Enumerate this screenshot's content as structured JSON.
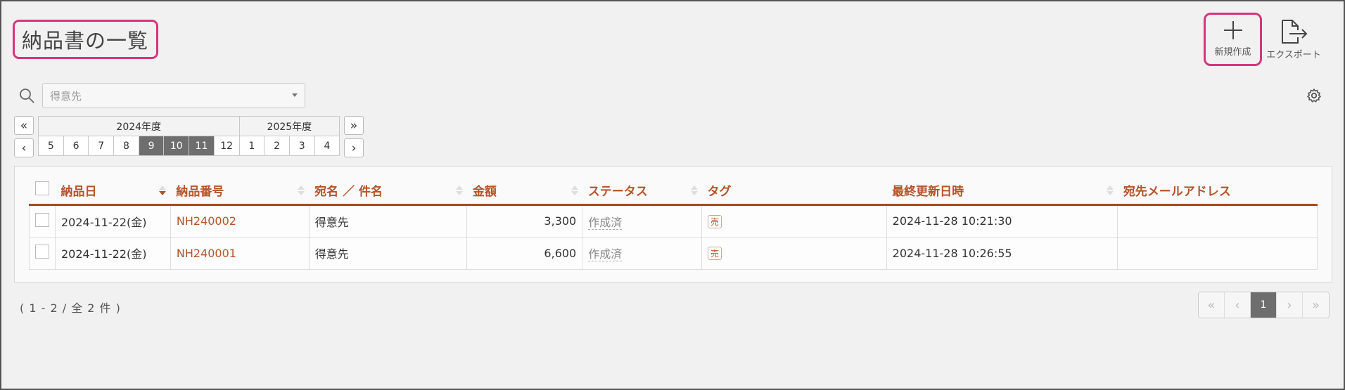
{
  "page": {
    "title": "納品書の一覧"
  },
  "toolbar": {
    "new_label": "新規作成",
    "export_label": "エクスポート"
  },
  "search": {
    "placeholder": "得意先"
  },
  "period": {
    "prev_year": "«",
    "next_year": "»",
    "prev_month": "‹",
    "next_month": "›",
    "fiscal_years": [
      "2024年度",
      "2025年度"
    ],
    "months": [
      "5",
      "6",
      "7",
      "8",
      "9",
      "10",
      "11",
      "12",
      "1",
      "2",
      "3",
      "4"
    ],
    "selected_months": [
      "9",
      "10",
      "11"
    ]
  },
  "table": {
    "headers": [
      "納品日",
      "納品番号",
      "宛名 ／ 件名",
      "金額",
      "ステータス",
      "タグ",
      "最終更新日時",
      "宛先メールアドレス"
    ],
    "rows": [
      {
        "date": "2024-11-22(金)",
        "number": "NH240002",
        "recipient": "得意先",
        "amount": "3,300",
        "status": "作成済",
        "tag": "売",
        "updated": "2024-11-28 10:21:30",
        "email": ""
      },
      {
        "date": "2024-11-22(金)",
        "number": "NH240001",
        "recipient": "得意先",
        "amount": "6,600",
        "status": "作成済",
        "tag": "売",
        "updated": "2024-11-28 10:26:55",
        "email": ""
      }
    ]
  },
  "footer": {
    "count_text": "( 1 - 2 / 全 2 件 )",
    "pagination": {
      "first": "«",
      "prev": "‹",
      "current": "1",
      "next": "›",
      "last": "»"
    }
  },
  "colors": {
    "accent": "#b5532a",
    "highlight": "#d6367a",
    "selected": "#6e6e6e"
  }
}
